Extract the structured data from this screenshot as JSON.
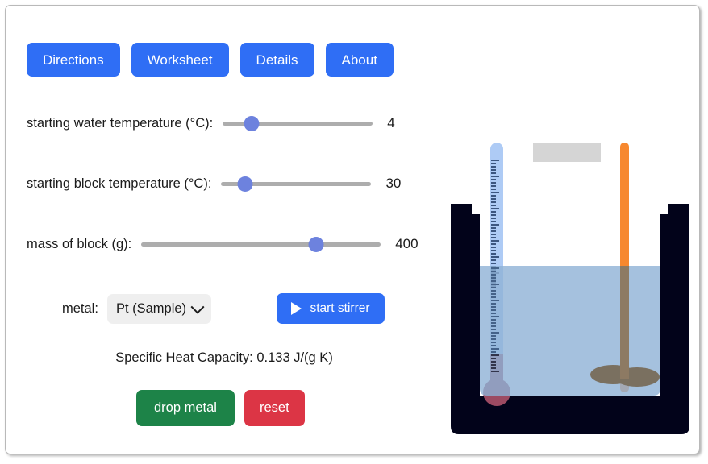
{
  "nav": {
    "items": [
      {
        "id": "directions",
        "label": "Directions"
      },
      {
        "id": "worksheet",
        "label": "Worksheet"
      },
      {
        "id": "details",
        "label": "Details"
      },
      {
        "id": "about",
        "label": "About"
      }
    ]
  },
  "controls": {
    "water_temp": {
      "label": "starting water temperature (°C):",
      "value": "4",
      "value_num": 4,
      "min": 0,
      "max": 100,
      "fill_percent": 19
    },
    "block_temp": {
      "label": "starting block temperature (°C):",
      "value": "30",
      "value_num": 30,
      "min": 0,
      "max": 300,
      "fill_percent": 16
    },
    "block_mass": {
      "label": "mass of block (g):",
      "value": "400",
      "value_num": 400,
      "min": 0,
      "max": 600,
      "fill_percent": 73
    }
  },
  "metal": {
    "label": "metal:",
    "selected": "Pt (Sample)",
    "options": [
      "Pt (Sample)"
    ]
  },
  "stirrer": {
    "label": "start stirrer",
    "icon": "play-icon"
  },
  "specific_heat": {
    "text": "Specific Heat Capacity: 0.133 J/(g K)",
    "value": "0.133",
    "units": "J/(g K)"
  },
  "actions": {
    "drop": "drop metal",
    "reset": "reset"
  },
  "apparatus": {
    "calorimeter": {
      "name": "calorimeter",
      "wall_color": "#02031a"
    },
    "water": {
      "name": "water",
      "color": "#8fb2d6",
      "level_label": "water surface"
    },
    "thermometer": {
      "name": "thermometer",
      "tube_color": "#aecbf5",
      "bulb_color": "#9c4a62",
      "tick_color": "#1f3a63"
    },
    "stirrer_rod": {
      "name": "stirrer",
      "rod_color": "#f7882f",
      "blade_color": "#7a7060"
    },
    "metal_block": {
      "name": "metal block",
      "color": "#d5d5d5"
    }
  },
  "colors": {
    "accent_blue": "#2f6ef5",
    "slider_thumb": "#6d82de",
    "slider_track": "#adadad",
    "green": "#1d8348",
    "red": "#dc3545"
  }
}
